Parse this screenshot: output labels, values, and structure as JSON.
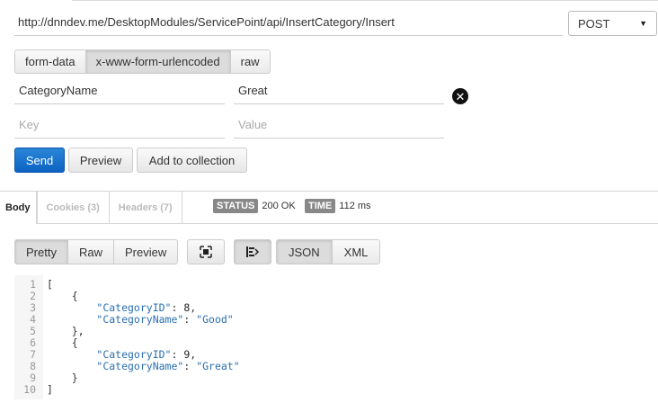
{
  "request": {
    "url": "http://dnndev.me/DesktopModules/ServicePoint/api/InsertCategory/Insert",
    "method": "POST",
    "body_types": [
      "form-data",
      "x-www-form-urlencoded",
      "raw"
    ],
    "params": [
      {
        "key": "CategoryName",
        "value": "Great"
      }
    ],
    "key_placeholder": "Key",
    "value_placeholder": "Value",
    "send_label": "Send",
    "preview_label": "Preview",
    "add_to_collection_label": "Add to collection"
  },
  "response": {
    "tabs": [
      {
        "label": "Body"
      },
      {
        "label": "Cookies (3)"
      },
      {
        "label": "Headers (7)"
      }
    ],
    "status_label": "STATUS",
    "status_value": "200 OK",
    "time_label": "TIME",
    "time_value": "112 ms",
    "view_modes": [
      "Pretty",
      "Raw",
      "Preview"
    ],
    "formats": [
      "JSON",
      "XML"
    ],
    "line_numbers": [
      "1",
      "2",
      "3",
      "4",
      "5",
      "6",
      "7",
      "8",
      "9",
      "10"
    ],
    "body": [
      {
        "CategoryID": 8,
        "CategoryName": "Good"
      },
      {
        "CategoryID": 9,
        "CategoryName": "Great"
      }
    ],
    "icons": {
      "fullscreen": "fullscreen-icon",
      "wrap": "wrap-lines-icon",
      "remove": "remove-circle-icon",
      "dropdown": "chevron-down-icon"
    }
  }
}
